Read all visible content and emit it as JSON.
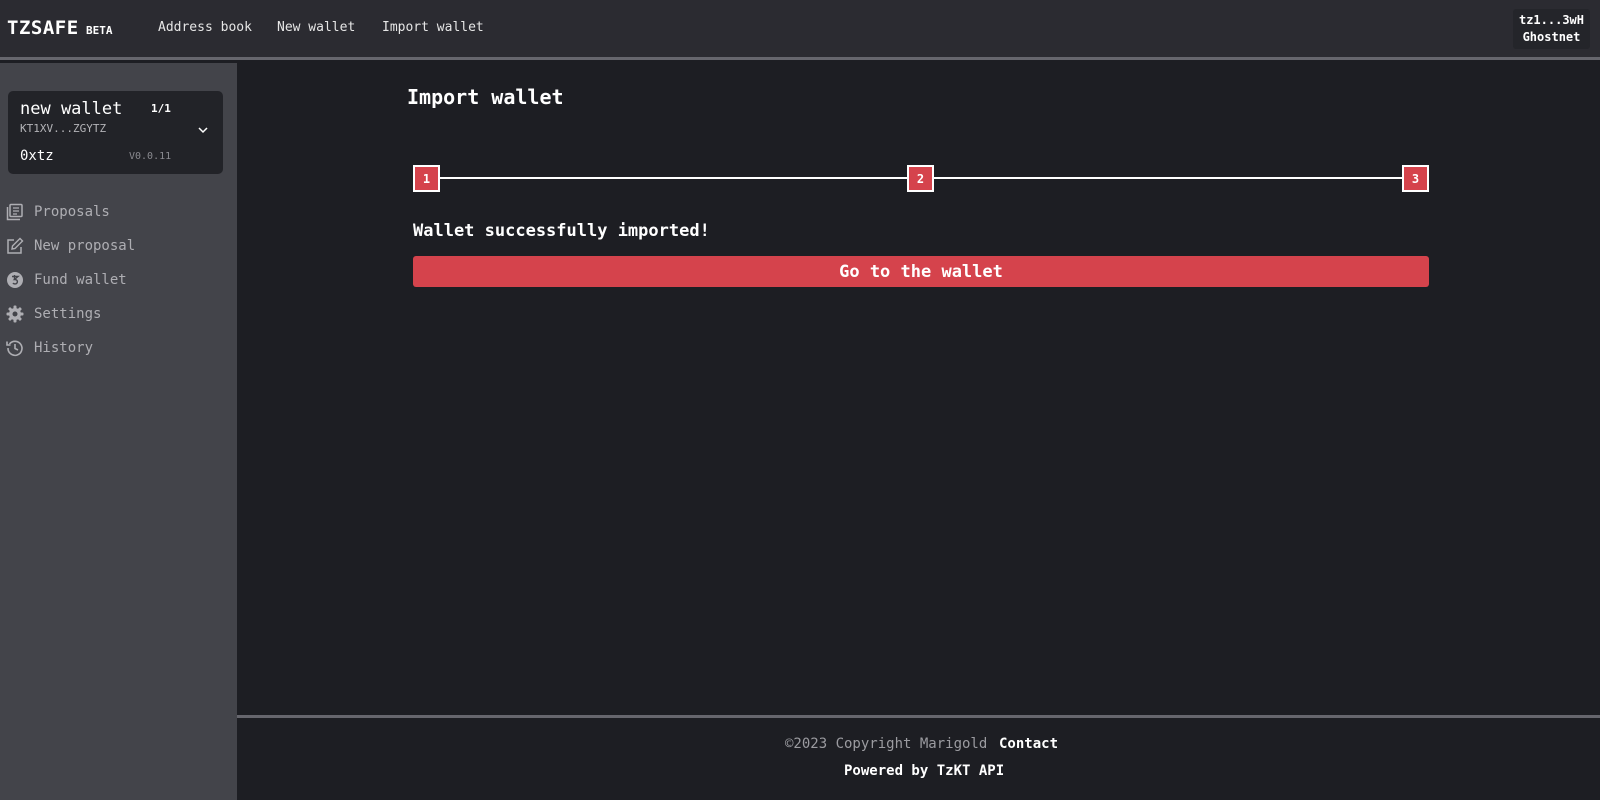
{
  "header": {
    "logo": "TZSAFE",
    "badge": "BETA",
    "nav": [
      {
        "label": "Address book"
      },
      {
        "label": "New wallet"
      },
      {
        "label": "Import wallet"
      }
    ],
    "account": {
      "address": "tz1...3wH",
      "network": "Ghostnet"
    }
  },
  "sidebar": {
    "wallet": {
      "name": "new wallet",
      "threshold": "1/1",
      "address": "KT1XV...ZGYTZ",
      "balance": "0xtz",
      "version": "V0.0.11"
    },
    "items": [
      {
        "label": "Proposals",
        "icon": "proposals-icon"
      },
      {
        "label": "New proposal",
        "icon": "edit-icon"
      },
      {
        "label": "Fund wallet",
        "icon": "tezos-coin-icon"
      },
      {
        "label": "Settings",
        "icon": "gear-icon"
      },
      {
        "label": "History",
        "icon": "history-icon"
      }
    ]
  },
  "main": {
    "title": "Import wallet",
    "steps": [
      "1",
      "2",
      "3"
    ],
    "success_message": "Wallet successfully imported!",
    "go_button": "Go to the wallet"
  },
  "footer": {
    "copyright": "©2023 Copyright Marigold",
    "contact": "Contact",
    "powered_by": "Powered by TzKT API"
  },
  "colors": {
    "accent": "#d5434c",
    "background": "#1d1e23",
    "sidebar": "#43444a",
    "header": "#2b2b31"
  }
}
